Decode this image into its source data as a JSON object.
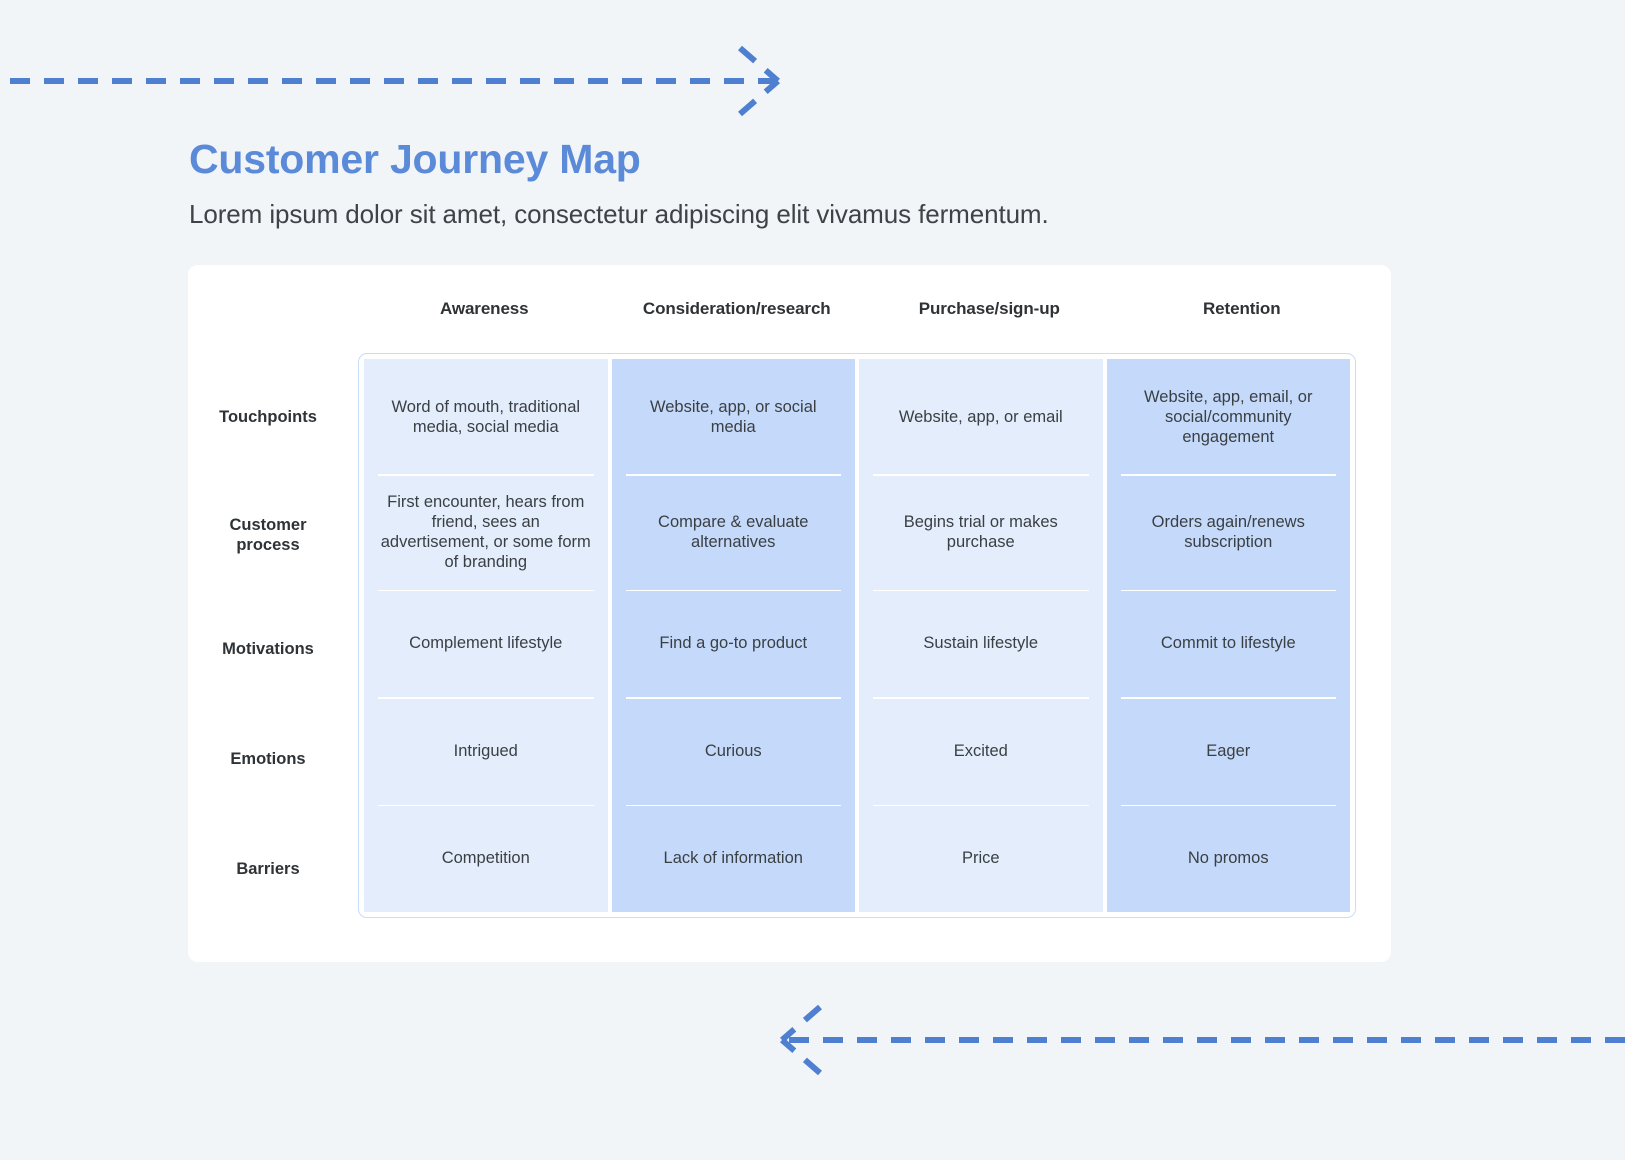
{
  "header": {
    "title": "Customer Journey Map",
    "subtitle": "Lorem ipsum dolor sit amet, consectetur adipiscing elit vivamus fermentum."
  },
  "colors": {
    "page_background": "#f1f5f7",
    "card_background": "#ffffff",
    "title_blue": "#5b8ad9",
    "arrow_blue": "#4f7fd0",
    "grid_border": "#c8ddf8",
    "column_light": "#e3edfc",
    "column_dark": "#c5dafa",
    "divider_white": "#ffffff",
    "body_text": "#3a3f43"
  },
  "decorations": {
    "top_arrow": {
      "name": "dashed-arrow-right",
      "direction": "right"
    },
    "bottom_arrow": {
      "name": "dashed-arrow-left",
      "direction": "left"
    }
  },
  "chart_data": {
    "type": "table",
    "title": "Customer Journey Map",
    "columns": [
      "Awareness",
      "Consideration/research",
      "Purchase/sign-up",
      "Retention"
    ],
    "rows": [
      "Touchpoints",
      "Customer process",
      "Motivations",
      "Emotions",
      "Barriers"
    ],
    "column_tones": [
      "light",
      "dark",
      "light",
      "dark"
    ],
    "cells": [
      [
        "Word of mouth, traditional media, social media",
        "Website, app, or social media",
        "Website, app, or email",
        "Website, app, email, or social/community engagement"
      ],
      [
        "First encounter, hears from friend, sees an advertisement, or some form of branding",
        "Compare & evaluate alternatives",
        "Begins trial or makes purchase",
        "Orders again/renews subscription"
      ],
      [
        "Complement lifestyle",
        "Find a go-to product",
        "Sustain lifestyle",
        "Commit to lifestyle"
      ],
      [
        "Intrigued",
        "Curious",
        "Excited",
        "Eager"
      ],
      [
        "Competition",
        "Lack of information",
        "Price",
        "No promos"
      ]
    ]
  }
}
